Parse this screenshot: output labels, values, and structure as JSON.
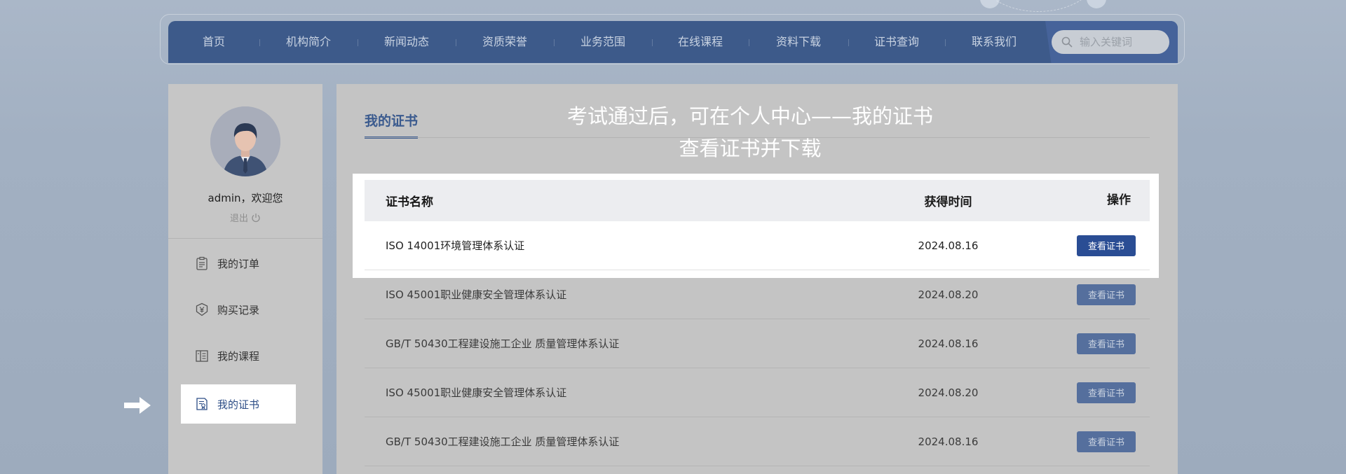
{
  "nav": {
    "items": [
      "首页",
      "机构简介",
      "新闻动态",
      "资质荣誉",
      "业务范围",
      "在线课程",
      "资料下载",
      "证书查询",
      "联系我们"
    ],
    "search_placeholder": "输入关键词"
  },
  "sidebar": {
    "welcome": "admin，欢迎您",
    "logout": "退出",
    "menu": [
      {
        "label": "我的订单",
        "icon": "clipboard-icon"
      },
      {
        "label": "购买记录",
        "icon": "yen-shield-icon"
      },
      {
        "label": "我的课程",
        "icon": "book-icon"
      },
      {
        "label": "我的证书",
        "icon": "certificate-icon",
        "active": true
      }
    ]
  },
  "main": {
    "tab": "我的证书",
    "caption_line1": "考试通过后，可在个人中心——我的证书",
    "caption_line2": "查看证书并下载",
    "table": {
      "headers": [
        "证书名称",
        "获得时间",
        "操作"
      ],
      "rows": [
        {
          "name": "ISO 14001环境管理体系认证",
          "time": "2024.08.16",
          "action": "查看证书"
        },
        {
          "name": "ISO 45001职业健康安全管理体系认证",
          "time": "2024.08.20",
          "action": "查看证书"
        },
        {
          "name": "GB/T 50430工程建设施工企业 质量管理体系认证",
          "time": "2024.08.16",
          "action": "查看证书"
        },
        {
          "name": "ISO 45001职业健康安全管理体系认证",
          "time": "2024.08.20",
          "action": "查看证书"
        },
        {
          "name": "GB/T 50430工程建设施工企业 质量管理体系认证",
          "time": "2024.08.16",
          "action": "查看证书"
        }
      ]
    }
  },
  "colors": {
    "nav_bg": "#3d5a8a",
    "accent": "#2a4d94",
    "active_text": "#2d4d86"
  }
}
